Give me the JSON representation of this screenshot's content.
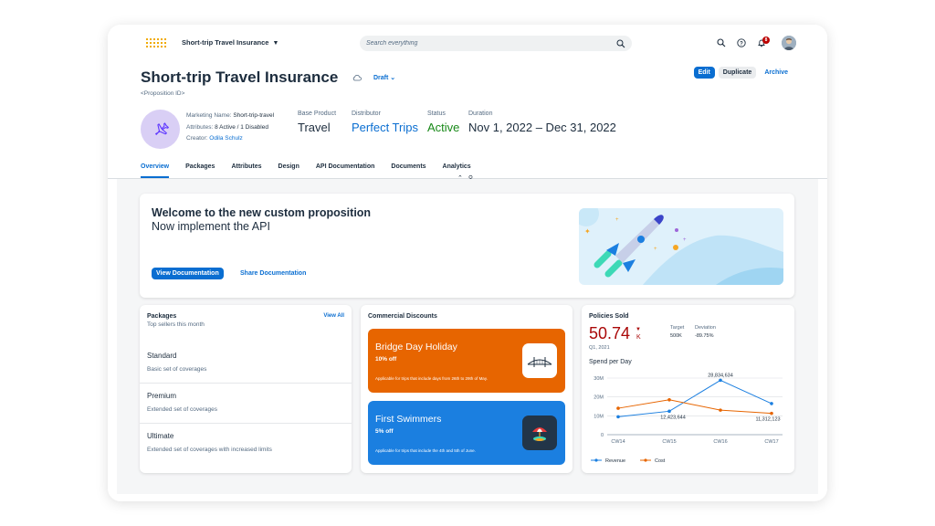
{
  "shell": {
    "app_title": "Short-trip Travel Insurance",
    "search_placeholder": "Search everything",
    "notification_count": "8"
  },
  "header": {
    "title": "Short-trip Travel Insurance",
    "status_menu": "Draft",
    "proposition_id": "<Proposition ID>",
    "actions": {
      "edit": "Edit",
      "duplicate": "Duplicate",
      "archive": "Archive"
    },
    "attributes": {
      "marketing_name_label": "Marketing Name:",
      "marketing_name": "Short-trip-travel",
      "attributes_label": "Attributes:",
      "attributes": "8 Active / 1 Disabled",
      "creator_label": "Creator:",
      "creator": "Odila Schulz"
    },
    "kpis": [
      {
        "label": "Base Product",
        "value": "Travel",
        "color": "#1d2d3e"
      },
      {
        "label": "Distributor",
        "value": "Perfect Trips",
        "color": "#0a6ed1"
      },
      {
        "label": "Status",
        "value": "Active",
        "color": "#188918"
      },
      {
        "label": "Duration",
        "value": "Nov 1, 2022 – Dec 31, 2022",
        "color": "#1d2d3e"
      }
    ]
  },
  "tabs": [
    "Overview",
    "Packages",
    "Attributes",
    "Design",
    "API Documentation",
    "Documents",
    "Analytics"
  ],
  "welcome": {
    "title": "Welcome to the new custom proposition",
    "subtitle": "Now implement the API",
    "view_button": "View Documentation",
    "share_button": "Share Documentation"
  },
  "packages": {
    "title": "Packages",
    "subtitle": "Top sellers this month",
    "view_all": "View All",
    "items": [
      {
        "name": "Standard",
        "desc": "Basic set of coverages"
      },
      {
        "name": "Premium",
        "desc": "Extended set of coverages"
      },
      {
        "name": "Ultimate",
        "desc": "Extended set of coverages with increased limits"
      }
    ]
  },
  "discounts": {
    "title": "Commercial Discounts",
    "items": [
      {
        "title": "Bridge Day Holiday",
        "percent": "10% off",
        "desc": "Applicable for trips that include days from 26th to 29th of May.",
        "color": "#e76500"
      },
      {
        "title": "First Swimmers",
        "percent": "5% off",
        "desc": "Applicable for trips that include the 4th and 5th of June.",
        "color": "#1b7fe0"
      }
    ]
  },
  "policies": {
    "title": "Policies Sold",
    "value": "50.74",
    "unit": "K",
    "period": "Q1, 2021",
    "target_label": "Target",
    "target": "500K",
    "deviation_label": "Deviation",
    "deviation": "-89.75%",
    "chart_title": "Spend per Day"
  },
  "chart_data": {
    "type": "line",
    "categories": [
      "CW14",
      "CW15",
      "CW16",
      "CW17"
    ],
    "ylim": [
      0,
      30000000
    ],
    "yticks": [
      "30M",
      "20M",
      "10M",
      "0"
    ],
    "series": [
      {
        "name": "Revenue",
        "color": "#1b7fe0",
        "values": [
          9500000,
          12423644,
          28834634,
          16500000
        ]
      },
      {
        "name": "Cost",
        "color": "#e76500",
        "values": [
          14000000,
          18500000,
          13000000,
          11312123
        ]
      }
    ],
    "data_labels": [
      "28,834,634",
      "12,423,644",
      "11,312,123"
    ]
  }
}
